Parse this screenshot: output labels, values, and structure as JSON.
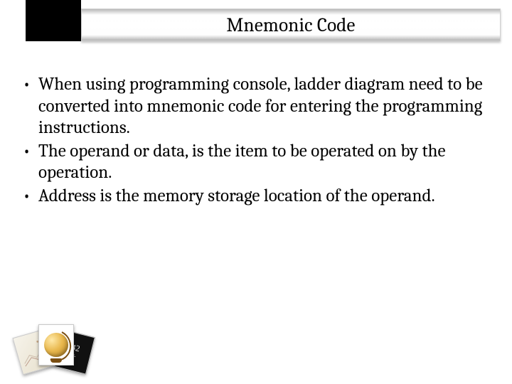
{
  "title": "Mnemonic Code",
  "bullets": [
    "When using programming console, ladder diagram need to be converted into mnemonic code for entering the programming instructions.",
    "The operand or data, is the item to be operated on by the operation.",
    "Address is the memory storage location of the operand."
  ],
  "decor": {
    "math_digits": "42",
    "math_plus": "+"
  }
}
